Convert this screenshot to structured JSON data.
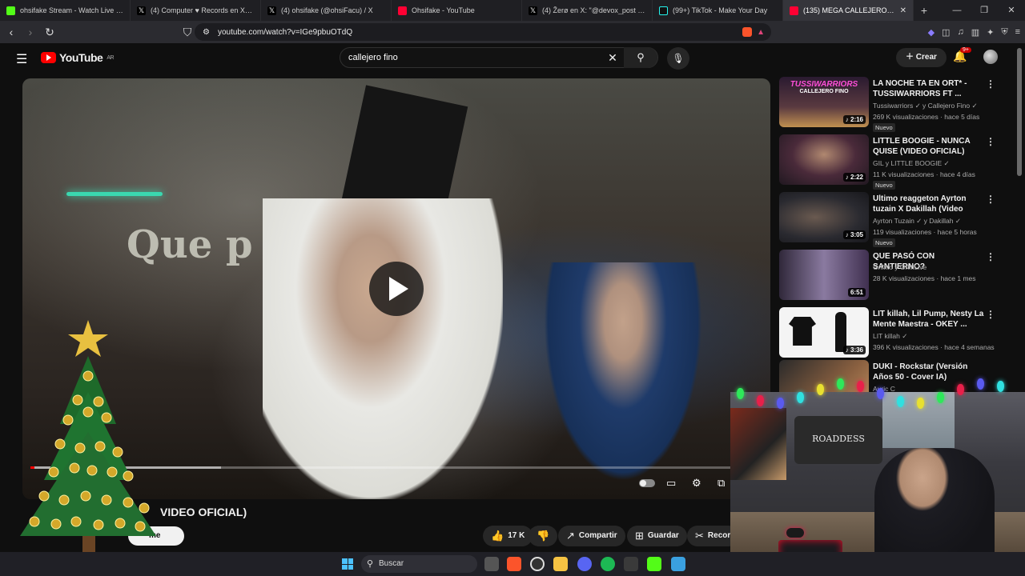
{
  "browser": {
    "tabs": [
      {
        "title": "ohsifake Stream - Watch Live on",
        "color": "#53fc18"
      },
      {
        "title": "(4) Computer ♥ Records en X: \"PlayS",
        "color": "#ffffff"
      },
      {
        "title": "(4) ohsifake (@ohsiFacu) / X",
        "color": "#ffffff"
      },
      {
        "title": "Ohsifake - YouTube",
        "color": "#ff0033"
      },
      {
        "title": "(4) Žerø en X: \"@devox_post Se pue",
        "color": "#ffffff"
      },
      {
        "title": "(99+) TikTok - Make Your Day",
        "color": "#25f4ee"
      },
      {
        "title": "(135) MEGA CALLEJERO FINO R",
        "color": "#ff0033"
      }
    ],
    "new_tab": "+",
    "url": "youtube.com/watch?v=IGe9pbuOTdQ"
  },
  "youtube": {
    "logo_text": "YouTube",
    "region": "AR",
    "search_query": "callejero fino",
    "create_label": "Crear",
    "notifications_badge": "9+",
    "video": {
      "title_visible": "VIDEO OFICIAL)",
      "subscribe_label": "me",
      "progress_played_pct": 0.6,
      "progress_loaded_pct": 26,
      "wall_text": "Que p",
      "poster_text": "ROADDESS"
    },
    "actions": {
      "likes": "17 K",
      "share": "Compartir",
      "save": "Guardar",
      "clip": "Recor"
    },
    "recommendations": [
      {
        "title": "LA NOCHE TA EN ORT* - TUSSIWARRIORS FT ...",
        "channel": "Tussiwarriors ✓ y Callejero Fino ✓",
        "meta": "269 K visualizaciones · hace 5 días",
        "badge": "Nuevo",
        "duration": "♪ 2:16",
        "thumb_text": "TUSSIWARRIORS",
        "thumb_sub": "CALLEJERO FINO",
        "color": "#3b2a4a"
      },
      {
        "title": "LITTLE BOOGIE - NUNCA QUISE (VIDEO OFICIAL)",
        "channel": "GIL y LITTLE BOOGIE ✓",
        "meta": "11 K visualizaciones · hace 4 días",
        "badge": "Nuevo",
        "duration": "♪ 2:22",
        "thumb_text": "",
        "thumb_sub": "",
        "color": "#4a3a44"
      },
      {
        "title": "Ultimo reaggeton Ayrton tuzain X Dakillah (Video Oficial) prod ...",
        "channel": "Ayrton Tuzain ✓ y Dakillah ✓",
        "meta": "119 visualizaciones · hace 5 horas",
        "badge": "Nuevo",
        "duration": "♪ 3:05",
        "thumb_text": "",
        "thumb_sub": "",
        "color": "#2e3038"
      },
      {
        "title": "QUE PASÓ CON SANTIERNO?",
        "channel": "Griffito y GriffiLive",
        "meta": "28 K visualizaciones · hace 1 mes",
        "badge": "",
        "duration": "6:51",
        "thumb_text": "",
        "thumb_sub": "",
        "color": "#3a3050"
      },
      {
        "title": "LIT killah, Lil Pump, Nesty La Mente Maestra - OKEY ...",
        "channel": "LIT killah ✓",
        "meta": "396 K visualizaciones · hace 4 semanas",
        "badge": "",
        "duration": "♪ 3:36",
        "thumb_text": "",
        "thumb_sub": "",
        "color": "#f2f2f2"
      },
      {
        "title": "DUKI - Rockstar (Versión Años 50 - Cover IA)",
        "channel": "Auric C",
        "meta": "",
        "badge": "",
        "duration": "",
        "thumb_text": "",
        "thumb_sub": "",
        "color": "#6a4a30"
      }
    ]
  },
  "taskbar": {
    "search_placeholder": "Buscar"
  }
}
